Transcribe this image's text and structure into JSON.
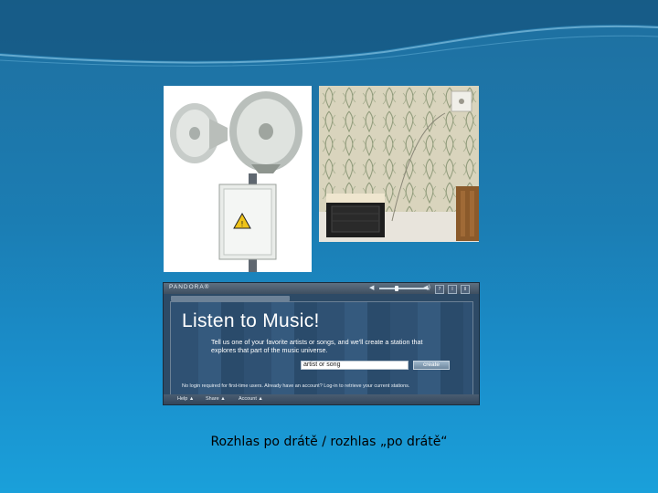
{
  "slide": {
    "caption": "Rozhlas po drátě / rozhlas „po drátě“"
  },
  "images": {
    "horns": {
      "icon": "horn-loudspeakers-photo"
    },
    "room": {
      "icon": "wall-speaker-room-photo"
    }
  },
  "pandora": {
    "logo": "PANDORA®",
    "title": "Listen to Music!",
    "description": "Tell us one of your favorite artists or songs, and we'll create a station that explores that part of the music universe.",
    "input_value": "artist or song",
    "create_label": "create",
    "footer_note": "No login required for first-time users. Already have an account? Log-in to retrieve your current stations.",
    "bottom_links": [
      "Help ▲",
      "Share ▲",
      "Account ▲"
    ],
    "top_buttons": [
      "?",
      "I",
      "II"
    ],
    "volume_icon": "speaker-icon",
    "volume_level": 0.35
  },
  "colors": {
    "background_top": "#1f6f9f",
    "background_bottom": "#1aa0da",
    "pandora_panel": "#2d4a66"
  }
}
